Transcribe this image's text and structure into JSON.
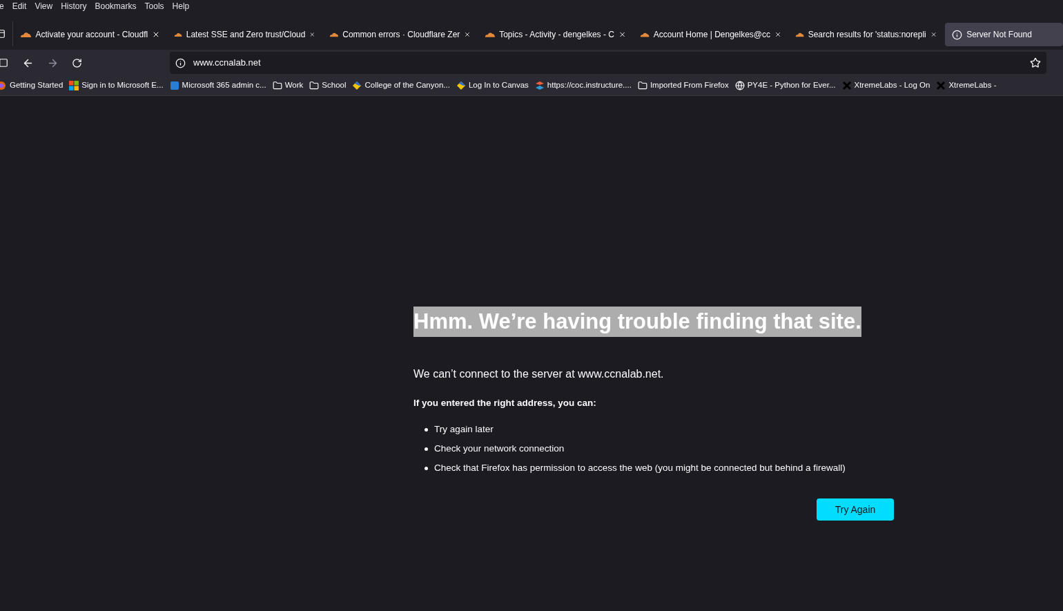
{
  "menu": [
    "e",
    "Edit",
    "View",
    "History",
    "Bookmarks",
    "Tools",
    "Help"
  ],
  "tabs": [
    {
      "label": "Activate your account - Cloudfl",
      "kind": "cloud",
      "selected": false
    },
    {
      "label": "Latest SSE and Zero trust/Cloud",
      "kind": "cloud",
      "selected": false
    },
    {
      "label": "Common errors · Cloudflare Zer",
      "kind": "cloud",
      "selected": false
    },
    {
      "label": "Topics - Activity - dengelkes - C",
      "kind": "cloud",
      "selected": false
    },
    {
      "label": "Account Home | Dengelkes@cc",
      "kind": "cloud",
      "selected": false
    },
    {
      "label": "Search results for 'status:norepli",
      "kind": "cloud",
      "selected": false
    },
    {
      "label": "Server Not Found",
      "kind": "info",
      "selected": true
    }
  ],
  "address": {
    "value": "www.ccnalab.net"
  },
  "bookmarks": [
    {
      "label": "Getting Started",
      "kind": "firefox"
    },
    {
      "label": "Sign in to Microsoft E...",
      "kind": "microsoft"
    },
    {
      "label": "Microsoft 365 admin c...",
      "kind": "m365"
    },
    {
      "label": "Work",
      "kind": "folder"
    },
    {
      "label": "School",
      "kind": "folder"
    },
    {
      "label": "College of the Canyon...",
      "kind": "canvas"
    },
    {
      "label": "Log In to Canvas",
      "kind": "canvas"
    },
    {
      "label": "https://coc.instructure....",
      "kind": "instructure"
    },
    {
      "label": "Imported From Firefox",
      "kind": "folder"
    },
    {
      "label": "PY4E - Python for Ever...",
      "kind": "globe"
    },
    {
      "label": "XtremeLabs - Log On",
      "kind": "xtreme"
    },
    {
      "label": "XtremeLabs -",
      "kind": "xtreme"
    }
  ],
  "error": {
    "title": "Hmm. We’re having trouble finding that site.",
    "title_selected": true,
    "message": "We can’t connect to the server at www.ccnalab.net.",
    "subheading": "If you entered the right address, you can:",
    "suggestions": [
      "Try again later",
      "Check your network connection",
      "Check that Firefox has permission to access the web (you might be connected but behind a firewall)"
    ],
    "button": "Try Again"
  }
}
